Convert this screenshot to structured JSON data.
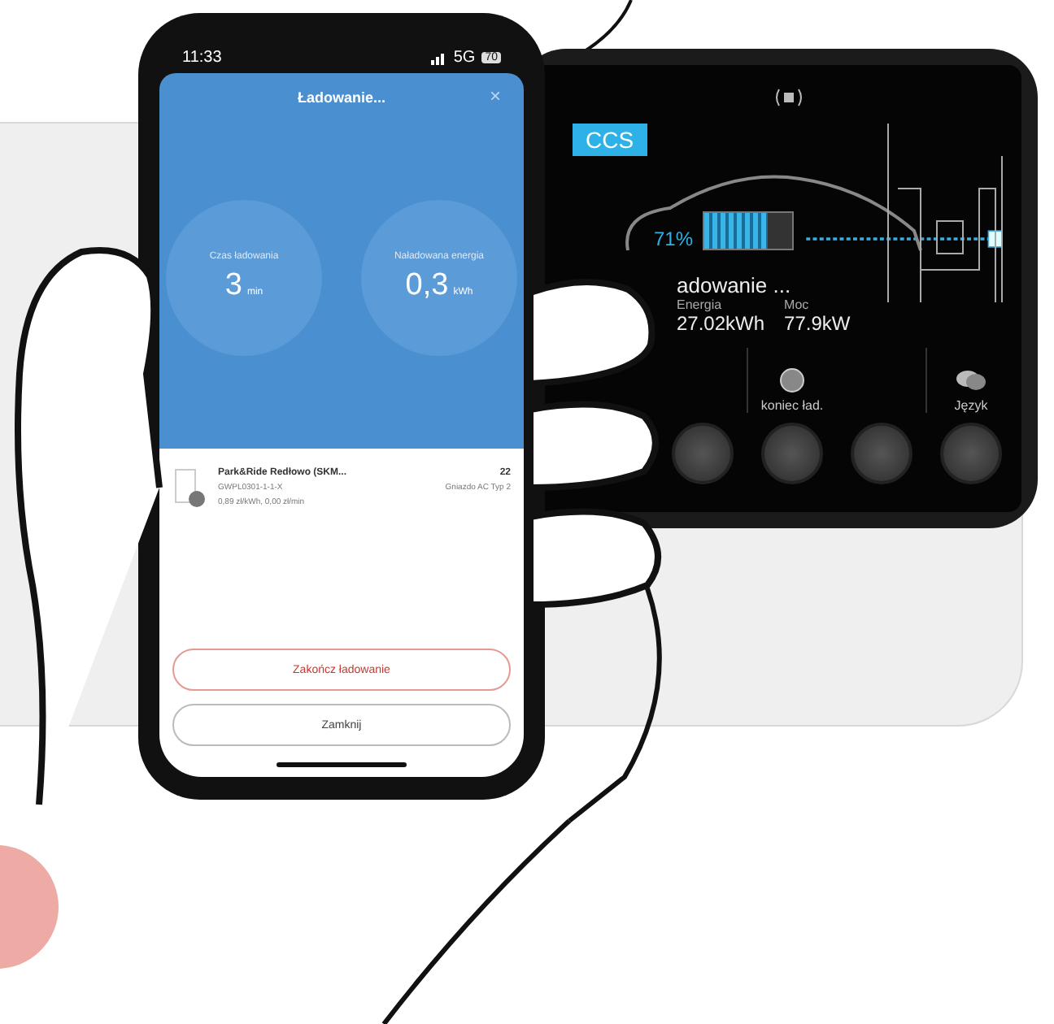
{
  "phone": {
    "status": {
      "time": "11:33",
      "network": "5G",
      "battery": "70"
    },
    "title": "Ładowanie...",
    "close": "×",
    "stats": [
      {
        "label": "Czas ładowania",
        "value": "3",
        "unit": "min"
      },
      {
        "label": "Naładowana energia",
        "value": "0,3",
        "unit": "kWh"
      }
    ],
    "station": {
      "name": "Park&Ride Redłowo (SKM...",
      "code": "GWPL0301-1-1-X",
      "price": "0,89 zł/kWh, 0,00 zł/min",
      "power": "22",
      "connector": "Gniazdo AC Typ 2"
    },
    "buttons": [
      {
        "label": "Zakończ ładowanie",
        "kind": "danger"
      },
      {
        "label": "Zamknij",
        "kind": "plain"
      }
    ]
  },
  "charger": {
    "connector": "CCS",
    "battery": {
      "reading": "71%",
      "level": 0.71
    },
    "status": "adowanie ...",
    "readings": [
      {
        "label": "Energia",
        "value": "27.02kWh"
      },
      {
        "label": "Moc",
        "value": "77.9kW"
      }
    ],
    "actions": [
      {
        "label": "koniec ład.",
        "kind": "stop"
      },
      {
        "label": "Język",
        "kind": "language"
      }
    ]
  }
}
